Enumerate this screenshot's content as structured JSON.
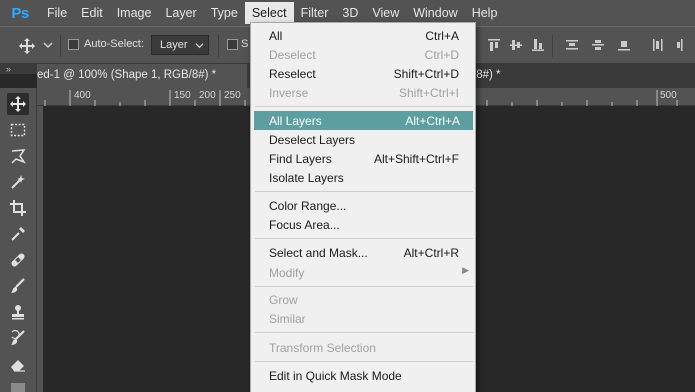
{
  "app": {
    "logo": "Ps"
  },
  "menubar": {
    "items": [
      "File",
      "Edit",
      "Image",
      "Layer",
      "Type",
      "Select",
      "Filter",
      "3D",
      "View",
      "Window",
      "Help"
    ],
    "active": "Select"
  },
  "options": {
    "auto_select_label": "Auto-Select:",
    "auto_select_value": "Layer",
    "show_transform_label": "S"
  },
  "tabs": {
    "doc1_title": "ed-1 @ 100% (Shape 1, RGB/8#) *",
    "doc1_close": "×",
    "doc2_title": "/8#) *"
  },
  "ruler": {
    "labels": [
      "400",
      "150",
      "200",
      "250",
      "500"
    ]
  },
  "select_menu": {
    "items": [
      {
        "label": "All",
        "shortcut": "Ctrl+A",
        "enabled": true
      },
      {
        "label": "Deselect",
        "shortcut": "Ctrl+D",
        "enabled": false
      },
      {
        "label": "Reselect",
        "shortcut": "Shift+Ctrl+D",
        "enabled": true
      },
      {
        "label": "Inverse",
        "shortcut": "Shift+Ctrl+I",
        "enabled": false
      },
      {
        "label": "All Layers",
        "shortcut": "Alt+Ctrl+A",
        "enabled": true,
        "highlighted": true
      },
      {
        "label": "Deselect Layers",
        "shortcut": "",
        "enabled": true
      },
      {
        "label": "Find Layers",
        "shortcut": "Alt+Shift+Ctrl+F",
        "enabled": true
      },
      {
        "label": "Isolate Layers",
        "shortcut": "",
        "enabled": true
      },
      {
        "label": "Color Range...",
        "shortcut": "",
        "enabled": true
      },
      {
        "label": "Focus Area...",
        "shortcut": "",
        "enabled": true
      },
      {
        "label": "Select and Mask...",
        "shortcut": "Alt+Ctrl+R",
        "enabled": true
      },
      {
        "label": "Modify",
        "shortcut": "",
        "enabled": false,
        "submenu": true
      },
      {
        "label": "Grow",
        "shortcut": "",
        "enabled": false
      },
      {
        "label": "Similar",
        "shortcut": "",
        "enabled": false
      },
      {
        "label": "Transform Selection",
        "shortcut": "",
        "enabled": false
      },
      {
        "label": "Edit in Quick Mask Mode",
        "shortcut": "",
        "enabled": true
      }
    ]
  },
  "colors": {
    "highlight": "#5d9fa0",
    "menubar": "#535353",
    "canvas": "#282828",
    "ps_blue": "#31a8ff"
  }
}
